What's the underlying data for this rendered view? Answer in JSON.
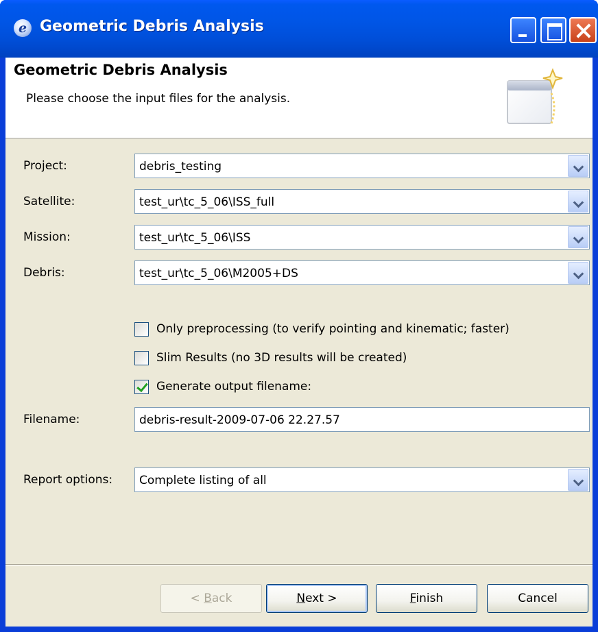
{
  "window": {
    "title": "Geometric Debris Analysis",
    "icon": "eclipse-icon",
    "title_icon_glyph": "e"
  },
  "banner": {
    "title": "Geometric Debris Analysis",
    "description": "Please choose the input files for the analysis."
  },
  "form": {
    "project": {
      "label": "Project:",
      "value": "debris_testing"
    },
    "satellite": {
      "label": "Satellite:",
      "value": "test_ur\\tc_5_06\\ISS_full"
    },
    "mission": {
      "label": "Mission:",
      "value": "test_ur\\tc_5_06\\ISS"
    },
    "debris": {
      "label": "Debris:",
      "value": "test_ur\\tc_5_06\\M2005+DS"
    },
    "only_preprocessing": {
      "label": "Only preprocessing (to verify pointing and kinematic; faster)",
      "checked": false
    },
    "slim_results": {
      "label": "Slim Results (no 3D results will be created)",
      "checked": false
    },
    "generate_filename": {
      "label": "Generate output filename:",
      "checked": true
    },
    "filename": {
      "label": "Filename:",
      "value": "debris-result-2009-07-06 22.27.57"
    },
    "report_options": {
      "label": "Report options:",
      "value": "Complete listing of all"
    }
  },
  "buttons": {
    "back": {
      "prefix": "< ",
      "mnemonic": "B",
      "rest": "ack",
      "enabled": false
    },
    "next": {
      "mnemonic": "N",
      "rest": "ext >",
      "enabled": true
    },
    "finish": {
      "mnemonic": "F",
      "rest": "inish",
      "enabled": true
    },
    "cancel": {
      "label": "Cancel",
      "enabled": true
    }
  },
  "colors": {
    "titlebar": "#0055e5",
    "dialog_bg": "#ece9d8",
    "check_mark": "#21a121"
  }
}
